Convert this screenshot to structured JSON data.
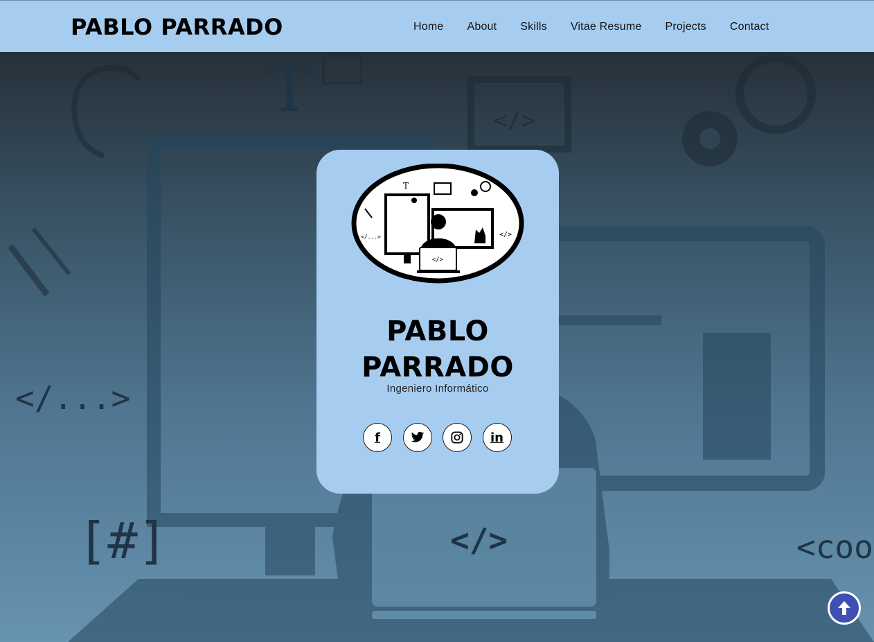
{
  "header": {
    "brand": "PABLO PARRADO",
    "nav": [
      {
        "label": "Home"
      },
      {
        "label": "About"
      },
      {
        "label": "Skills"
      },
      {
        "label": "Vitae Resume"
      },
      {
        "label": "Projects"
      },
      {
        "label": "Contact"
      }
    ]
  },
  "hero": {
    "background_glyphs": [
      "</...>",
      "[#]",
      "</>",
      "<coo",
      "T"
    ]
  },
  "card": {
    "name_line1": "PABLO",
    "name_line2": "PARRADO",
    "role": "Ingeniero Informático",
    "logo_code_label": "</>",
    "socials": [
      {
        "icon": "facebook-icon",
        "label": "f"
      },
      {
        "icon": "twitter-icon"
      },
      {
        "icon": "instagram-icon"
      },
      {
        "icon": "linkedin-icon",
        "label": "in"
      }
    ]
  },
  "colors": {
    "header_bg": "#a6cdf0",
    "card_bg": "#a6cdf0",
    "scroll_top_bg": "#3f4fb3"
  }
}
